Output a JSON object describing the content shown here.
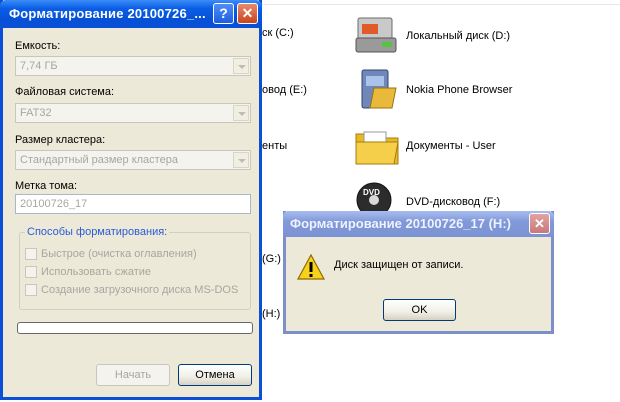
{
  "explorer": {
    "partial_items": [
      {
        "label": "ск (C:)"
      },
      {
        "label": "овод (E:)"
      },
      {
        "label": "енты"
      },
      {
        "label": "(G:)"
      },
      {
        "label": "(H:)"
      }
    ],
    "items": [
      {
        "label": "Локальный диск (D:)",
        "icon": "hard-drive-icon"
      },
      {
        "label": "Nokia Phone Browser",
        "icon": "phone-browser-icon"
      },
      {
        "label": "Документы - User",
        "icon": "folder-icon"
      },
      {
        "label": "DVD-дисковод (F:)",
        "icon": "dvd-drive-icon"
      }
    ]
  },
  "format_dialog": {
    "title": "Форматирование 20100726_...",
    "help_glyph": "?",
    "close_glyph": "✕",
    "capacity_label": "Емкость:",
    "capacity_value": "7,74 ГБ",
    "filesystem_label": "Файловая система:",
    "filesystem_value": "FAT32",
    "cluster_label": "Размер кластера:",
    "cluster_value": "Стандартный размер кластера",
    "volume_label": "Метка тома:",
    "volume_value": "20100726_17",
    "options_title": "Способы форматирования:",
    "options": [
      {
        "label": "Быстрое (очистка оглавления)",
        "checked": false
      },
      {
        "label": "Использовать сжатие",
        "checked": false
      },
      {
        "label": "Создание загрузочного диска MS-DOS",
        "checked": false
      }
    ],
    "progress": 0,
    "start_label": "Начать",
    "cancel_label": "Отмена"
  },
  "message_box": {
    "title": "Форматирование 20100726_17 (H:)",
    "close_glyph": "✕",
    "message": "Диск защищен от записи.",
    "ok_label": "OK",
    "icon": "warning-icon"
  },
  "colors": {
    "titlebar_active": "#0a4fd6",
    "titlebar_inactive": "#7b93d4",
    "dialog_bg": "#ece9d8",
    "group_title": "#2a5bd7"
  }
}
